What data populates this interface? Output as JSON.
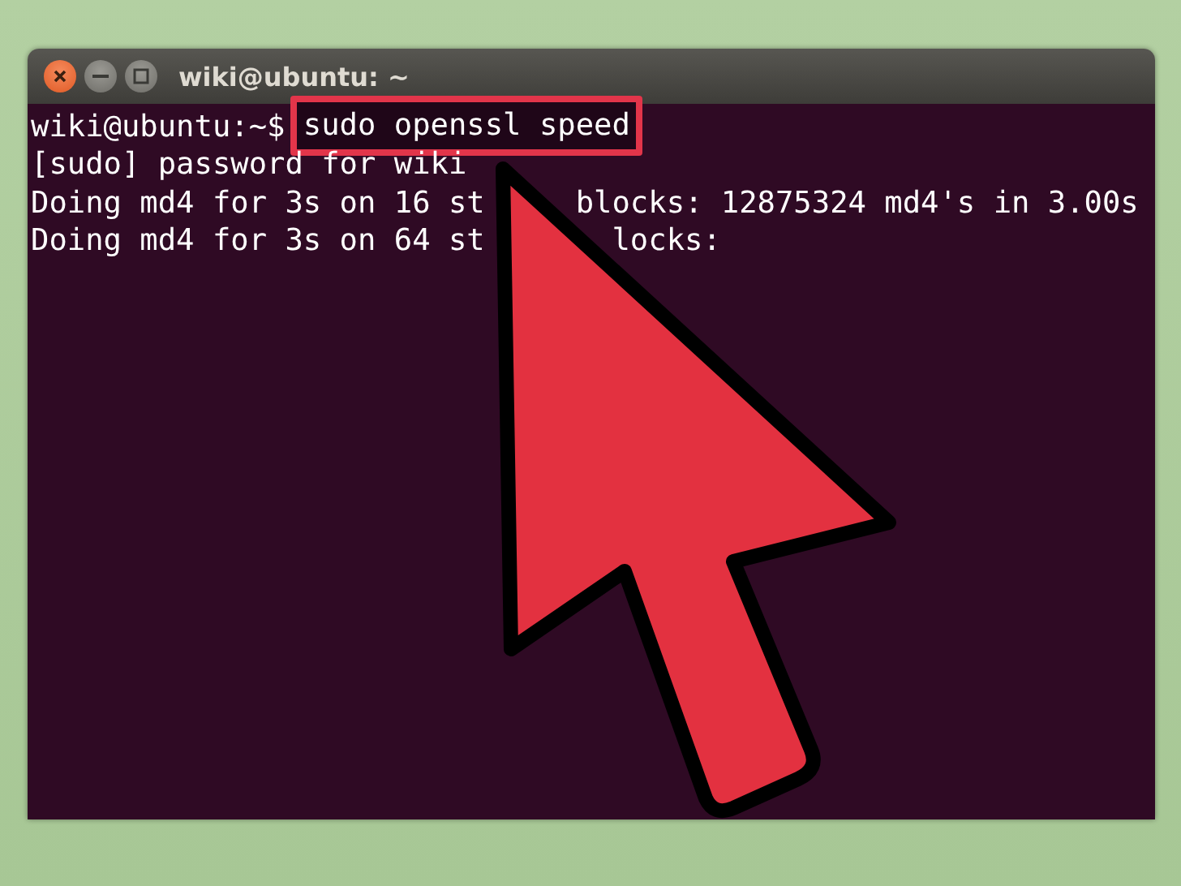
{
  "window": {
    "title": "wiki@ubuntu: ~"
  },
  "terminal": {
    "lines": [
      {
        "kind": "command",
        "prompt": "wiki@ubuntu:~$",
        "command": "sudo openssl speed",
        "highlighted": true
      },
      {
        "kind": "output",
        "segments": [
          "[sudo] password for wiki"
        ]
      },
      {
        "kind": "output",
        "segments": [
          "Doing md4 for 3s on 16 st",
          "blocks: 12875324 md4's in 3.00s"
        ]
      },
      {
        "kind": "output",
        "segments": [
          "Doing md4 for 3s on 64 st",
          "locks:"
        ]
      }
    ]
  }
}
